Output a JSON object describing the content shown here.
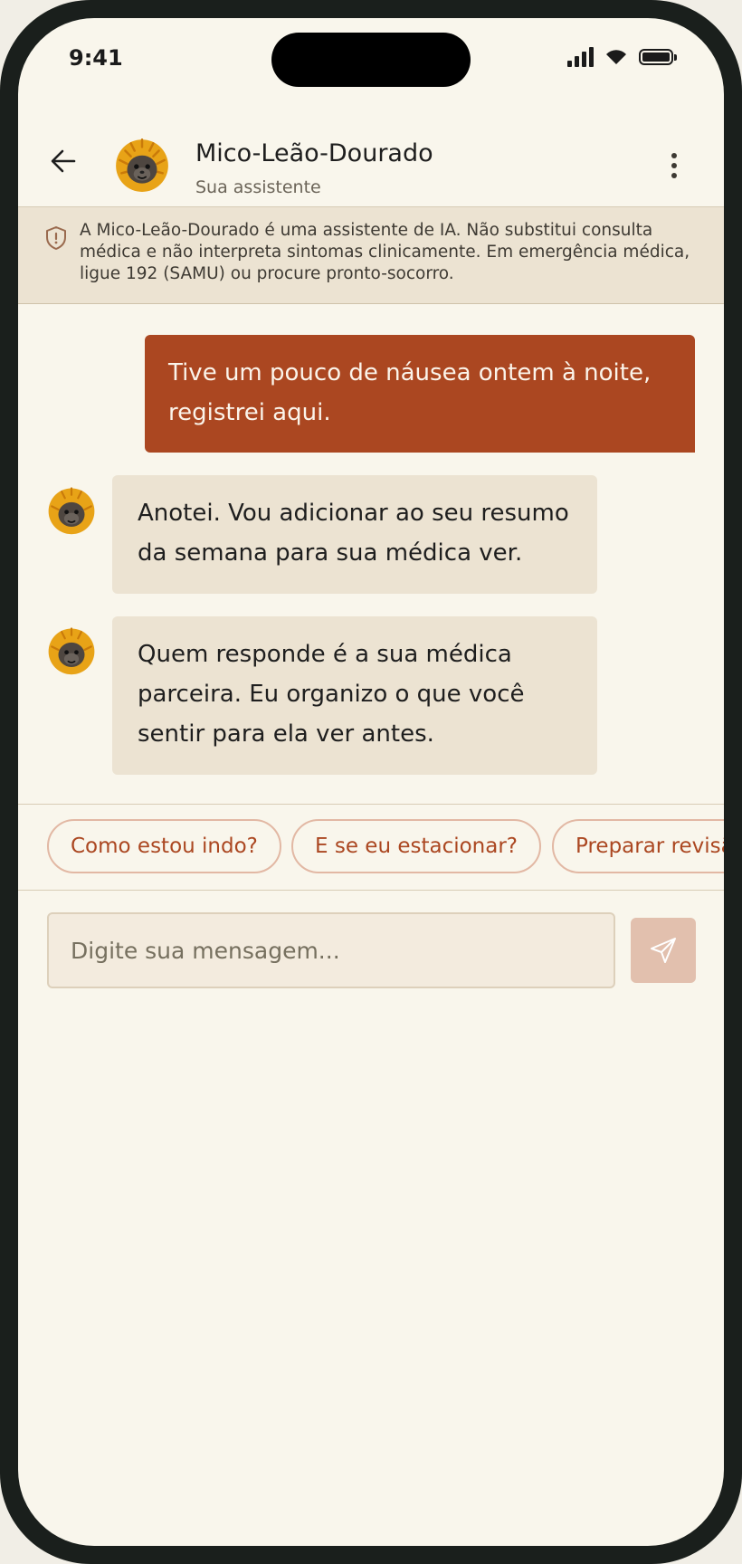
{
  "status_bar": {
    "time": "9:41",
    "signal_icon": "cellular-signal-icon",
    "wifi_icon": "wifi-icon",
    "battery_icon": "battery-icon"
  },
  "header": {
    "back_icon": "arrow-left-icon",
    "avatar_icon": "golden-lion-tamarin-icon",
    "title": "Mico-Leão-Dourado",
    "subtitle": "Sua assistente",
    "menu_icon": "more-vertical-icon"
  },
  "disclaimer": {
    "icon": "shield-alert-icon",
    "text": "A Mico-Leão-Dourado é uma assistente de IA. Não substitui consulta médica e não interpreta sintomas clinicamente. Em emergência médica, ligue 192 (SAMU) ou procure pronto-socorro."
  },
  "messages": [
    {
      "from": "user",
      "text": "Tive um pouco de náusea ontem à noite, registrei aqui."
    },
    {
      "from": "assistant",
      "text": "Anotei. Vou adicionar ao seu resumo da semana para sua médica ver."
    },
    {
      "from": "assistant",
      "text": "Quem responde é a sua médica parceira. Eu organizo o que você sentir para ela ver antes."
    }
  ],
  "quick_replies": [
    "Como estou indo?",
    "E se eu estacionar?",
    "Preparar revisão"
  ],
  "composer": {
    "placeholder": "Digite sua mensagem...",
    "value": "",
    "send_icon": "send-icon"
  },
  "colors": {
    "background": "#f9f6ec",
    "accent": "#ab4721",
    "bubble_bot": "#ece3d2",
    "disclaimer_bg": "#ece3d2",
    "send_disabled": "#e2c0ae"
  }
}
